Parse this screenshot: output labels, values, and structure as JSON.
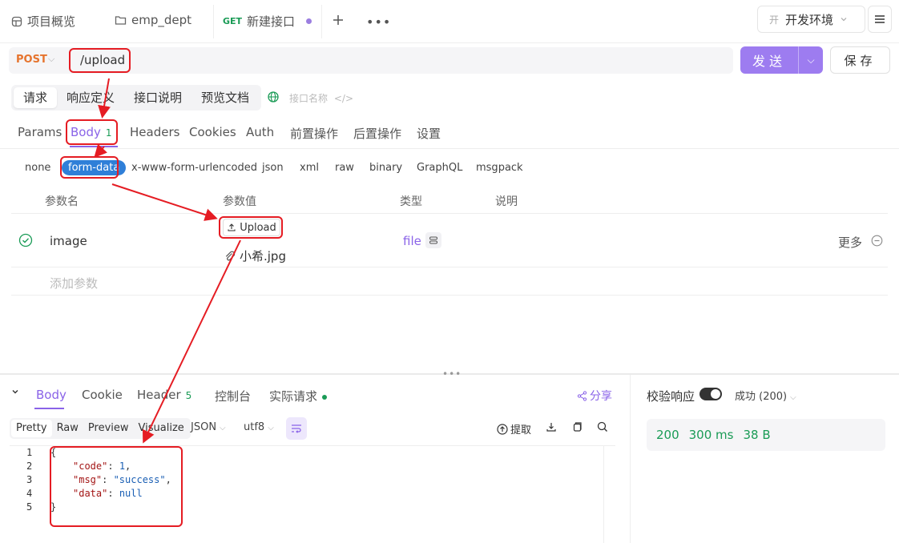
{
  "tabs": [
    {
      "label": "项目概览",
      "icon": "box-icon"
    },
    {
      "label": "emp_dept",
      "icon": "folder-icon"
    },
    {
      "method": "GET",
      "label": "新建接口",
      "unsaved": true
    }
  ],
  "environment": {
    "tag": "开",
    "label": "开发环境"
  },
  "request": {
    "method": "POST",
    "url": "/upload",
    "send_label": "发送",
    "save_label": "保存"
  },
  "segment_tabs": [
    "请求",
    "响应定义",
    "接口说明",
    "预览文档"
  ],
  "api_name_placeholder": "接口名称",
  "request_tabs": {
    "params": "Params",
    "body": "Body",
    "body_count": "1",
    "headers": "Headers",
    "cookies": "Cookies",
    "auth": "Auth",
    "pre": "前置操作",
    "post": "后置操作",
    "settings": "设置"
  },
  "body_types": [
    "none",
    "form-data",
    "x-www-form-urlencoded",
    "json",
    "xml",
    "raw",
    "binary",
    "GraphQL",
    "msgpack"
  ],
  "params_table": {
    "headers": {
      "name": "参数名",
      "value": "参数值",
      "type": "类型",
      "desc": "说明"
    },
    "row": {
      "name": "image",
      "upload_label": "Upload",
      "file_name": "小希.jpg",
      "type": "file",
      "more": "更多"
    },
    "add_placeholder": "添加参数"
  },
  "response_tabs": {
    "body": "Body",
    "cookie": "Cookie",
    "header": "Header",
    "header_count": "5",
    "console": "控制台",
    "actual": "实际请求",
    "share": "分享"
  },
  "format_tabs": [
    "Pretty",
    "Raw",
    "Preview",
    "Visualize"
  ],
  "format_dropdowns": {
    "format": "JSON",
    "encoding": "utf8"
  },
  "extract_label": "提取",
  "code": {
    "line_numbers": [
      "1",
      "2",
      "3",
      "4",
      "5"
    ],
    "open": "{",
    "close": "}",
    "code_key": "\"code\"",
    "code_val": "1",
    "msg_key": "\"msg\"",
    "msg_val": "\"success\"",
    "data_key": "\"data\"",
    "data_val": "null"
  },
  "verify": {
    "label": "校验响应",
    "enabled": true,
    "result": "成功 (200)"
  },
  "status": {
    "code": "200",
    "time": "300 ms",
    "size": "38 B"
  },
  "colors": {
    "accent": "#8a63e8",
    "send": "#9d7cf0",
    "method_post": "#e6742e",
    "success": "#1a9b56",
    "annotation": "#e51c23",
    "chip_active": "#2f7fd8"
  }
}
